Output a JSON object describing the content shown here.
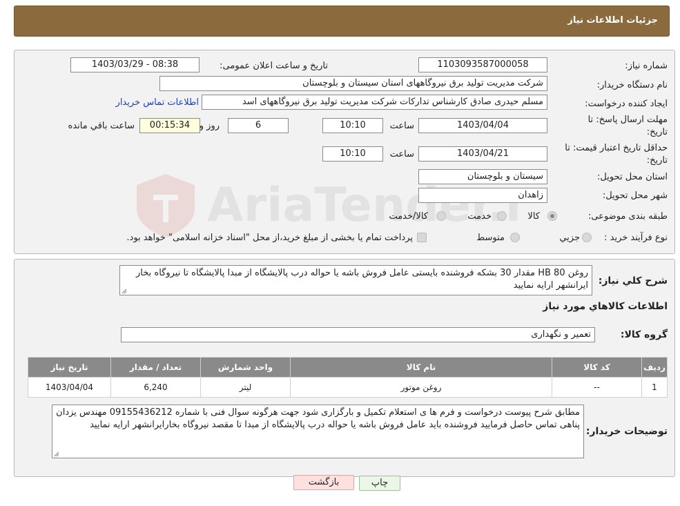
{
  "header": {
    "title": "جزئیات اطلاعات نیاز"
  },
  "details": {
    "need_number_label": "شماره نیاز:",
    "need_number": "1103093587000058",
    "announce_label": "تاریخ و ساعت اعلان عمومی:",
    "announce_value": "1403/03/29 - 08:38",
    "buyer_org_label": "نام دستگاه خریدار:",
    "buyer_org": "شرکت مدیریت تولید برق نیروگاههای استان سیستان و بلوچستان",
    "creator_label": "ایجاد کننده درخواست:",
    "creator": "مسلم حیدری صادق کارشناس تدارکات شرکت مدیریت تولید برق نیروگاههای اسد",
    "contact_link": "اطلاعات تماس خریدار",
    "deadline_label_1": "مهلت ارسال پاسخ: تا",
    "deadline_label_2": "تاریخ:",
    "deadline_date": "1403/04/04",
    "time_label": "ساعت",
    "deadline_time": "10:10",
    "days_value": "6",
    "days_label": "روز و",
    "remaining_time": "00:15:34",
    "remaining_label": "ساعت باقي مانده",
    "validity_label_1": "حداقل تاریخ اعتبار قیمت: تا",
    "validity_label_2": "تاریخ:",
    "validity_date": "1403/04/21",
    "validity_time": "10:10",
    "province_label": "استان محل تحویل:",
    "province": "سیستان و بلوچستان",
    "city_label": "شهر محل تحویل:",
    "city": "زاهدان",
    "category_label": "طبقه بندی موضوعی:",
    "category_options": [
      "کالا",
      "خدمت",
      "کالا/خدمت"
    ],
    "process_label": "نوع فرآیند خرید :",
    "process_options": [
      "جزیي",
      "متوسط"
    ],
    "payment_note": "پرداخت تمام یا بخشی از مبلغ خرید،از محل \"اسناد خزانه اسلامی\" خواهد بود."
  },
  "summary": {
    "label": "شرح کلي نياز:",
    "text": "روغن HB 80     مقدار  30 بشکه فروشنده بایستی عامل فروش باشه یا حواله درب پالایشگاه از مبدا پالایشگاه تا نیروگاه بخار ایرانشهر  ارایه نمایید"
  },
  "goods": {
    "section_title": "اطلاعات کالاهاي مورد نياز",
    "group_label": "گروه کالا:",
    "group_value": "تعمیر و نگهداری",
    "columns": [
      "رديف",
      "کد کالا",
      "نام کالا",
      "واحد شمارش",
      "تعداد / مقدار",
      "تاریخ نیاز"
    ],
    "rows": [
      [
        "1",
        "--",
        "روغن موتور",
        "لیتر",
        "6,240",
        "1403/04/04"
      ]
    ]
  },
  "buyer_notes": {
    "label": "توضیحات خریدار:",
    "text": "مطابق شرح پیوست درخواست  و فرم ها ی استعلام تکمیل و بارگزاری شود جهت هرگونه سوال فنی با شماره 09155436212 مهندس یزدان پناهی تماس حاصل فرمایید  فروشنده باید عامل فروش باشه یا حواله درب پالایشگاه از مبدا تا مقصد نیروگاه بخارایرانشهر ارایه نمایید"
  },
  "buttons": {
    "print": "چاپ",
    "back": "بازگشت"
  },
  "watermark": {
    "text": "AriaTender.neT"
  },
  "colors": {
    "header_bg": "#8b6b3d",
    "table_header_bg": "#8a8a8a",
    "link": "#1a3ec7"
  }
}
